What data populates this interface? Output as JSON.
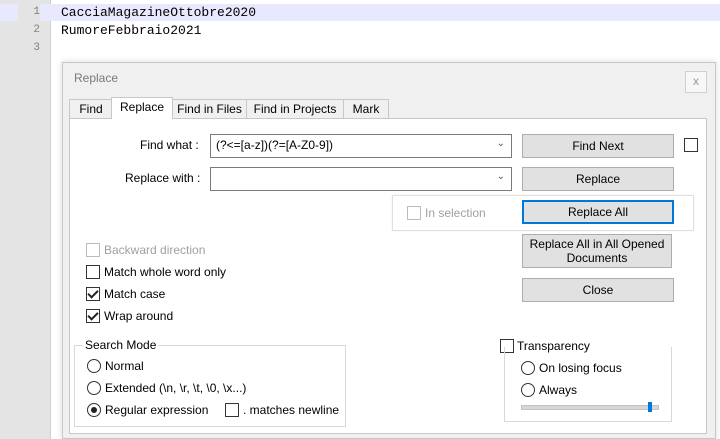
{
  "editor": {
    "lines": [
      {
        "num": "1",
        "text": "CacciaMagazineOttobre2020"
      },
      {
        "num": "2",
        "text": "RumoreFebbraio2021"
      },
      {
        "num": "3",
        "text": ""
      }
    ]
  },
  "dialog": {
    "title": "Replace",
    "close": "x",
    "tabs": [
      "Find",
      "Replace",
      "Find in Files",
      "Find in Projects",
      "Mark"
    ],
    "active_tab": "Replace",
    "find_label": "Find what :",
    "find_value": "(?<=[a-z])(?=[A-Z0-9])",
    "replace_label": "Replace with :",
    "replace_value": "",
    "in_selection": "In selection",
    "buttons": {
      "find_next": "Find Next",
      "replace": "Replace",
      "replace_all": "Replace All",
      "replace_all_opened": "Replace All in All Opened Documents",
      "close": "Close"
    },
    "options": {
      "backward": {
        "label": "Backward direction",
        "checked": false,
        "enabled": false
      },
      "whole_word": {
        "label": "Match whole word only",
        "checked": false
      },
      "match_case": {
        "label": "Match case",
        "checked": true
      },
      "wrap_around": {
        "label": "Wrap around",
        "checked": true
      }
    },
    "search_mode": {
      "title": "Search Mode",
      "normal": "Normal",
      "extended": "Extended (\\n, \\r, \\t, \\0, \\x...)",
      "regex": "Regular expression",
      "matches_newline": ". matches newline",
      "selected": "regex"
    },
    "transparency": {
      "title": "Transparency",
      "on_losing_focus": "On losing focus",
      "always": "Always",
      "level": 0.95
    }
  }
}
